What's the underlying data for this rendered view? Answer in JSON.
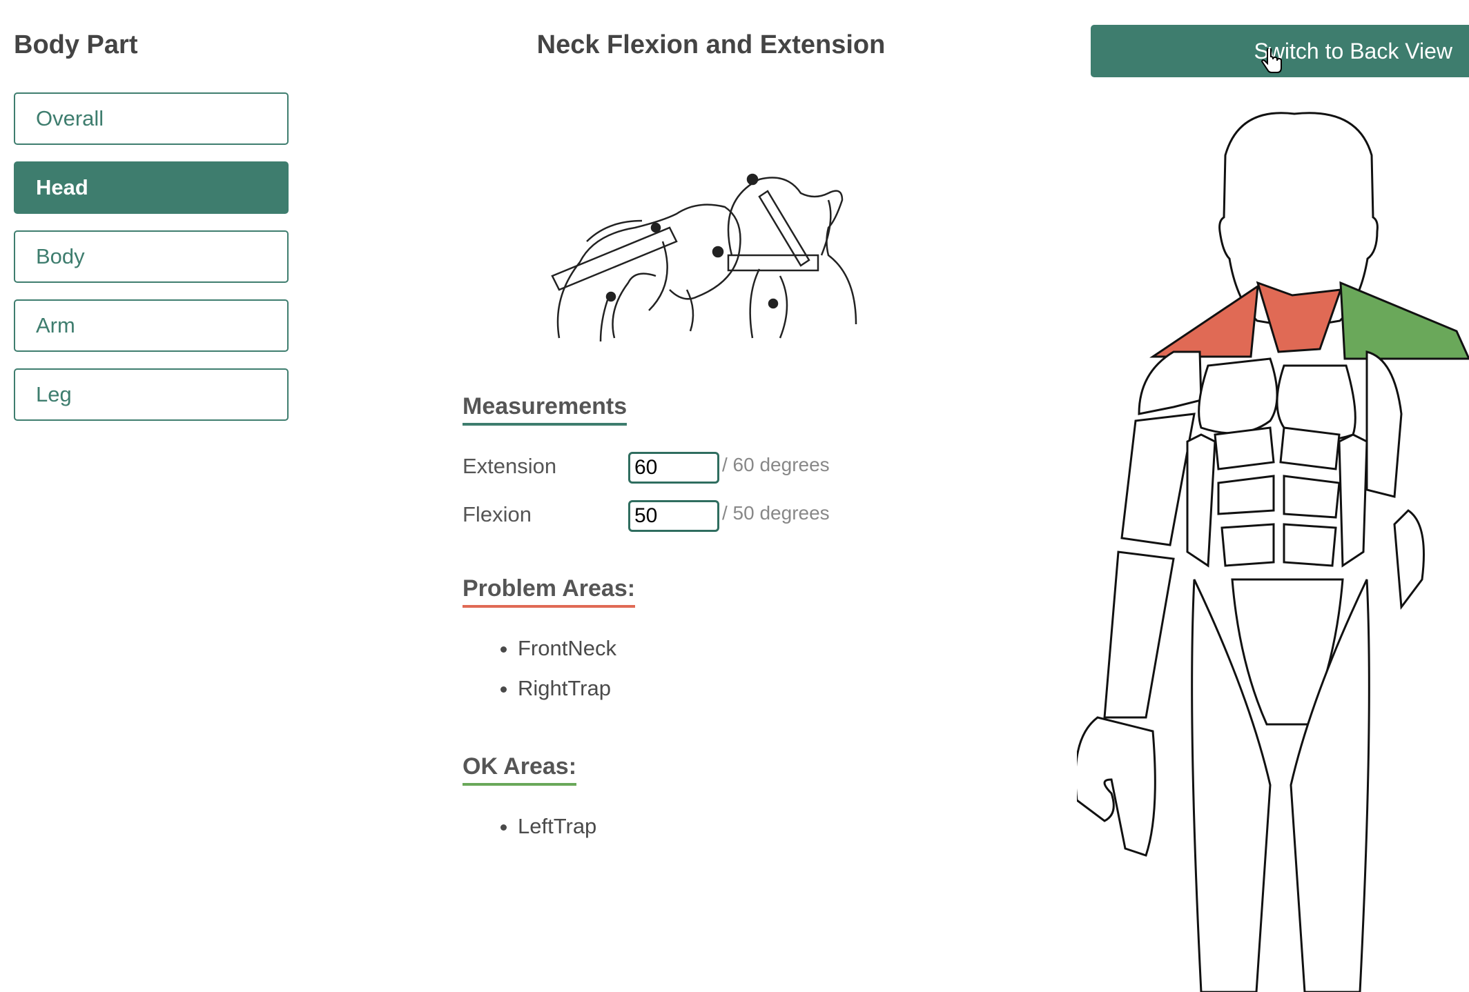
{
  "sidebar": {
    "title": "Body Part",
    "items": [
      {
        "label": "Overall",
        "active": false
      },
      {
        "label": "Head",
        "active": true
      },
      {
        "label": "Body",
        "active": false
      },
      {
        "label": "Arm",
        "active": false
      },
      {
        "label": "Leg",
        "active": false
      }
    ]
  },
  "header": {
    "title": "Neck Flexion and Extension",
    "switch_button": "Switch to Back View"
  },
  "measurements": {
    "heading": "Measurements",
    "rows": [
      {
        "label": "Extension",
        "value": "60",
        "max": "/ 60 degrees"
      },
      {
        "label": "Flexion",
        "value": "50",
        "max": "/ 50 degrees"
      }
    ]
  },
  "problem_areas": {
    "heading": "Problem Areas:",
    "items": [
      "FrontNeck",
      "RightTrap"
    ]
  },
  "ok_areas": {
    "heading": "OK Areas:",
    "items": [
      "LeftTrap"
    ]
  },
  "colors": {
    "accent": "#3e7d6e",
    "problem": "#e06a55",
    "ok": "#6aa85a"
  },
  "icons": {
    "cursor": "hand-pointer-icon",
    "illustration": "neck-flexion-extension-illustration",
    "diagram": "front-body-muscle-diagram"
  }
}
